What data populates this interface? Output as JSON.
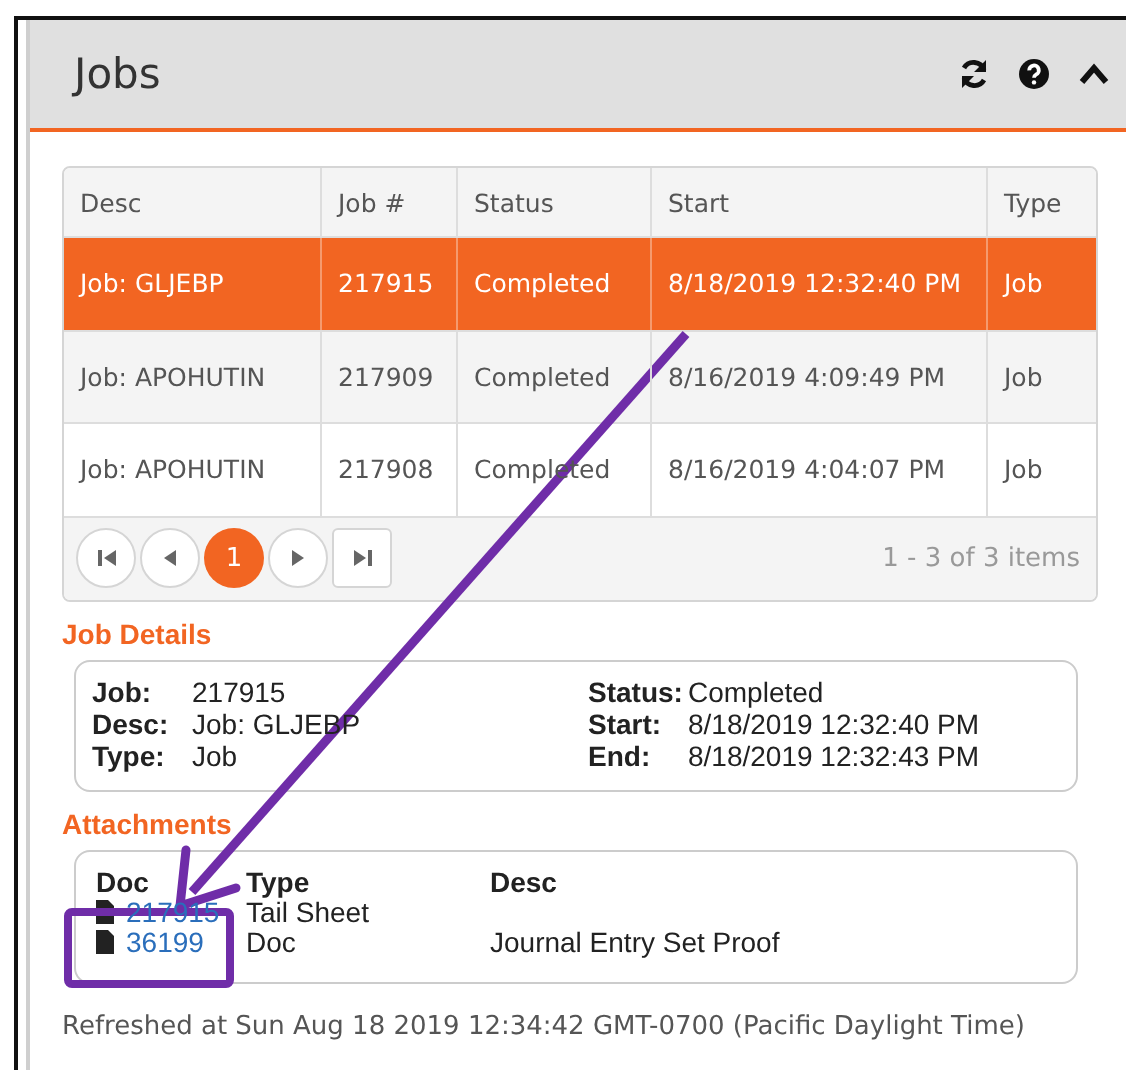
{
  "panel": {
    "title": "Jobs"
  },
  "table": {
    "columns": [
      "Desc",
      "Job #",
      "Status",
      "Start",
      "Type"
    ],
    "rows": [
      {
        "cells": [
          "Job: GLJEBP",
          "217915",
          "Completed",
          "8/18/2019 12:32:40 PM",
          "Job"
        ],
        "selected": true
      },
      {
        "cells": [
          "Job: APOHUTIN",
          "217909",
          "Completed",
          "8/16/2019 4:09:49 PM",
          "Job"
        ],
        "selected": false
      },
      {
        "cells": [
          "Job: APOHUTIN",
          "217908",
          "Completed",
          "8/16/2019 4:04:07 PM",
          "Job"
        ],
        "selected": false
      }
    ]
  },
  "pager": {
    "pages": [
      {
        "label": "1",
        "selected": true
      }
    ],
    "summary": "1 - 3 of 3 items"
  },
  "job_details": {
    "heading": "Job Details",
    "left": [
      {
        "label": "Job:",
        "value": "217915"
      },
      {
        "label": "Desc:",
        "value": "Job: GLJEBP"
      },
      {
        "label": "Type:",
        "value": "Job"
      }
    ],
    "right": [
      {
        "label": "Status:",
        "value": "Completed"
      },
      {
        "label": "Start:",
        "value": "8/18/2019 12:32:40 PM"
      },
      {
        "label": "End:",
        "value": "8/18/2019 12:32:43 PM"
      }
    ]
  },
  "attachments": {
    "heading": "Attachments",
    "columns": [
      "Doc",
      "Type",
      "Desc"
    ],
    "rows": [
      {
        "doc": "217915",
        "type": "Tail Sheet"
      },
      {
        "doc": "36199",
        "type": "Doc",
        "desc": "Journal Entry Set Proof"
      }
    ]
  },
  "status_bar": "Refreshed at Sun Aug 18 2019 12:34:42 GMT-0700 (Pacific Daylight Time)"
}
